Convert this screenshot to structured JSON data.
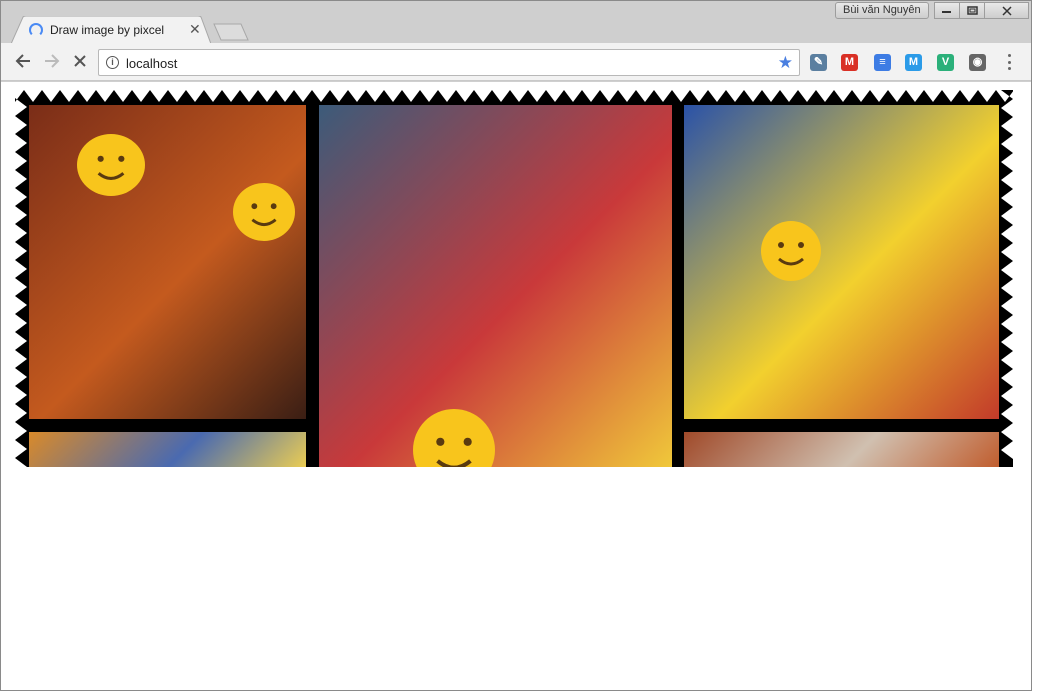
{
  "window": {
    "user_name": "Bùi văn Nguyên"
  },
  "tab": {
    "title": "Draw image by pixcel",
    "status": "loading"
  },
  "omnibox": {
    "url": "localhost",
    "bookmarked": true
  },
  "icons": {
    "back": "back-arrow-icon",
    "forward": "forward-arrow-icon",
    "reload": "stop-loading-icon",
    "info": "info-icon",
    "star": "star-icon",
    "menu": "more-vert-icon"
  },
  "extensions": [
    {
      "name": "eyedropper-icon",
      "color": "#5b7fa0",
      "glyph": "✎"
    },
    {
      "name": "gmail-icon",
      "color": "#d93025",
      "glyph": "M"
    },
    {
      "name": "google-docs-icon",
      "color": "#3d7ce4",
      "glyph": "≡"
    },
    {
      "name": "maps-m-icon",
      "color": "#2b9be8",
      "glyph": "M"
    },
    {
      "name": "vue-v-icon",
      "color": "#2bb07a",
      "glyph": "V"
    },
    {
      "name": "lightbulb-icon",
      "color": "#666666",
      "glyph": "◉"
    }
  ],
  "photos": [
    {
      "name": "photo-kids-pumpkins",
      "colors": [
        "#7a2d18",
        "#c45a1e",
        "#3a1e14"
      ]
    },
    {
      "name": "photo-play-structure",
      "colors": [
        "#3c5b7a",
        "#c9393a",
        "#f0c83a"
      ]
    },
    {
      "name": "photo-inflatable-slide",
      "colors": [
        "#2a52a8",
        "#f2d02e",
        "#c23a2a"
      ]
    },
    {
      "name": "photo-bottom-left",
      "colors": [
        "#d98a2a",
        "#4a6ab0",
        "#f0d050"
      ]
    },
    {
      "name": "photo-bottom-right",
      "colors": [
        "#a04a2a",
        "#d0c0b0",
        "#c05a2a"
      ]
    }
  ],
  "accent": "#4a8af4"
}
